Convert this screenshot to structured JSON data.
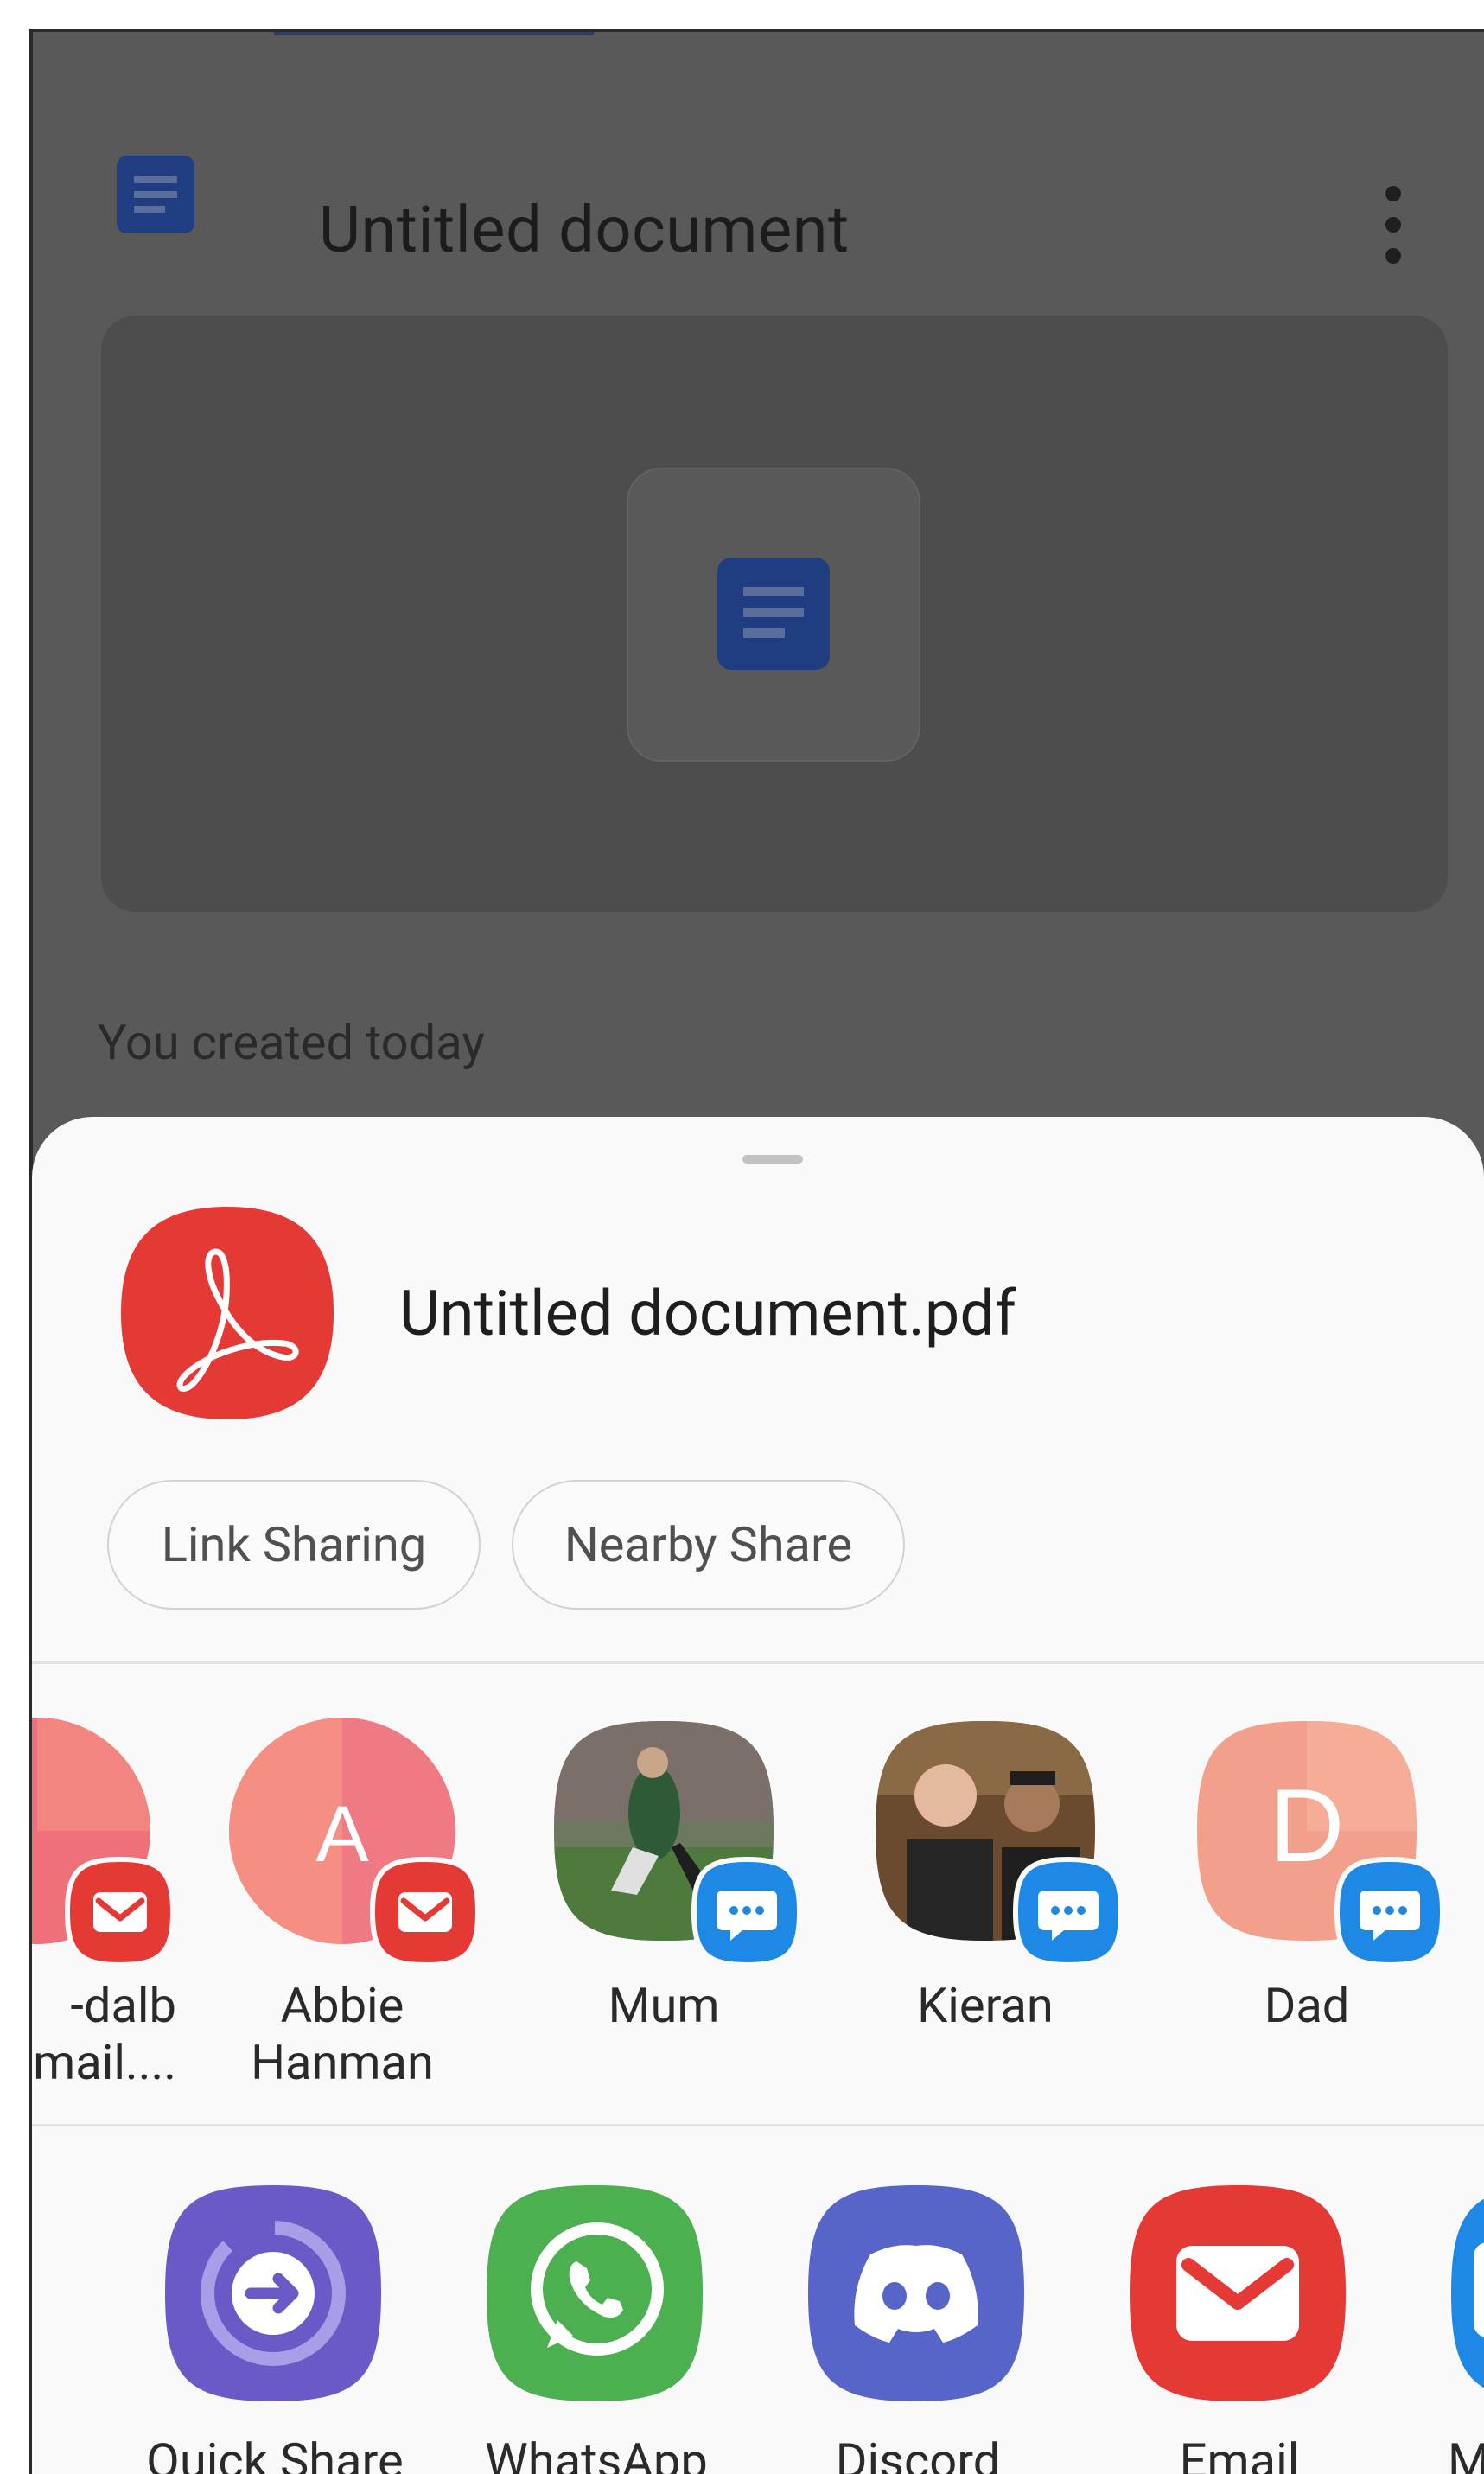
{
  "doc_screen": {
    "title": "Untitled document",
    "created_text": "You created today"
  },
  "share_sheet": {
    "file_name": "Untitled document.pdf",
    "chips": {
      "link_sharing": "Link Sharing",
      "nearby_share": "Nearby Share"
    },
    "contacts": [
      {
        "name_line1": "-dalb",
        "name_line2": "mail....",
        "avatar_letter": "",
        "badge": "email-badge-icon"
      },
      {
        "name_line1": "Abbie",
        "name_line2": "Hanman",
        "avatar_letter": "A",
        "badge": "email-badge-icon"
      },
      {
        "name_line1": "Mum",
        "name_line2": "",
        "avatar_letter": "",
        "badge": "message-badge-icon"
      },
      {
        "name_line1": "Kieran",
        "name_line2": "",
        "avatar_letter": "",
        "badge": "message-badge-icon"
      },
      {
        "name_line1": "Dad",
        "name_line2": "",
        "avatar_letter": "D",
        "badge": "message-badge-icon"
      }
    ],
    "apps": [
      {
        "label": "Quick Share",
        "icon": "quick-share-icon"
      },
      {
        "label": "WhatsApp",
        "icon": "whatsapp-icon"
      },
      {
        "label": "Discord",
        "icon": "discord-icon"
      },
      {
        "label": "Email",
        "icon": "email-icon"
      },
      {
        "label": "Me",
        "icon": "messages-icon"
      }
    ]
  },
  "colors": {
    "dim_background": "#595959",
    "sheet_background": "#f9f9f9",
    "pdf_red": "#e53935",
    "docs_blue": "#1a56c7",
    "quick_share_purple": "#6a5ac8",
    "whatsapp_green": "#4caf50",
    "discord_blurple": "#5865c8",
    "email_red": "#e53935",
    "message_blue": "#1e88e5"
  }
}
